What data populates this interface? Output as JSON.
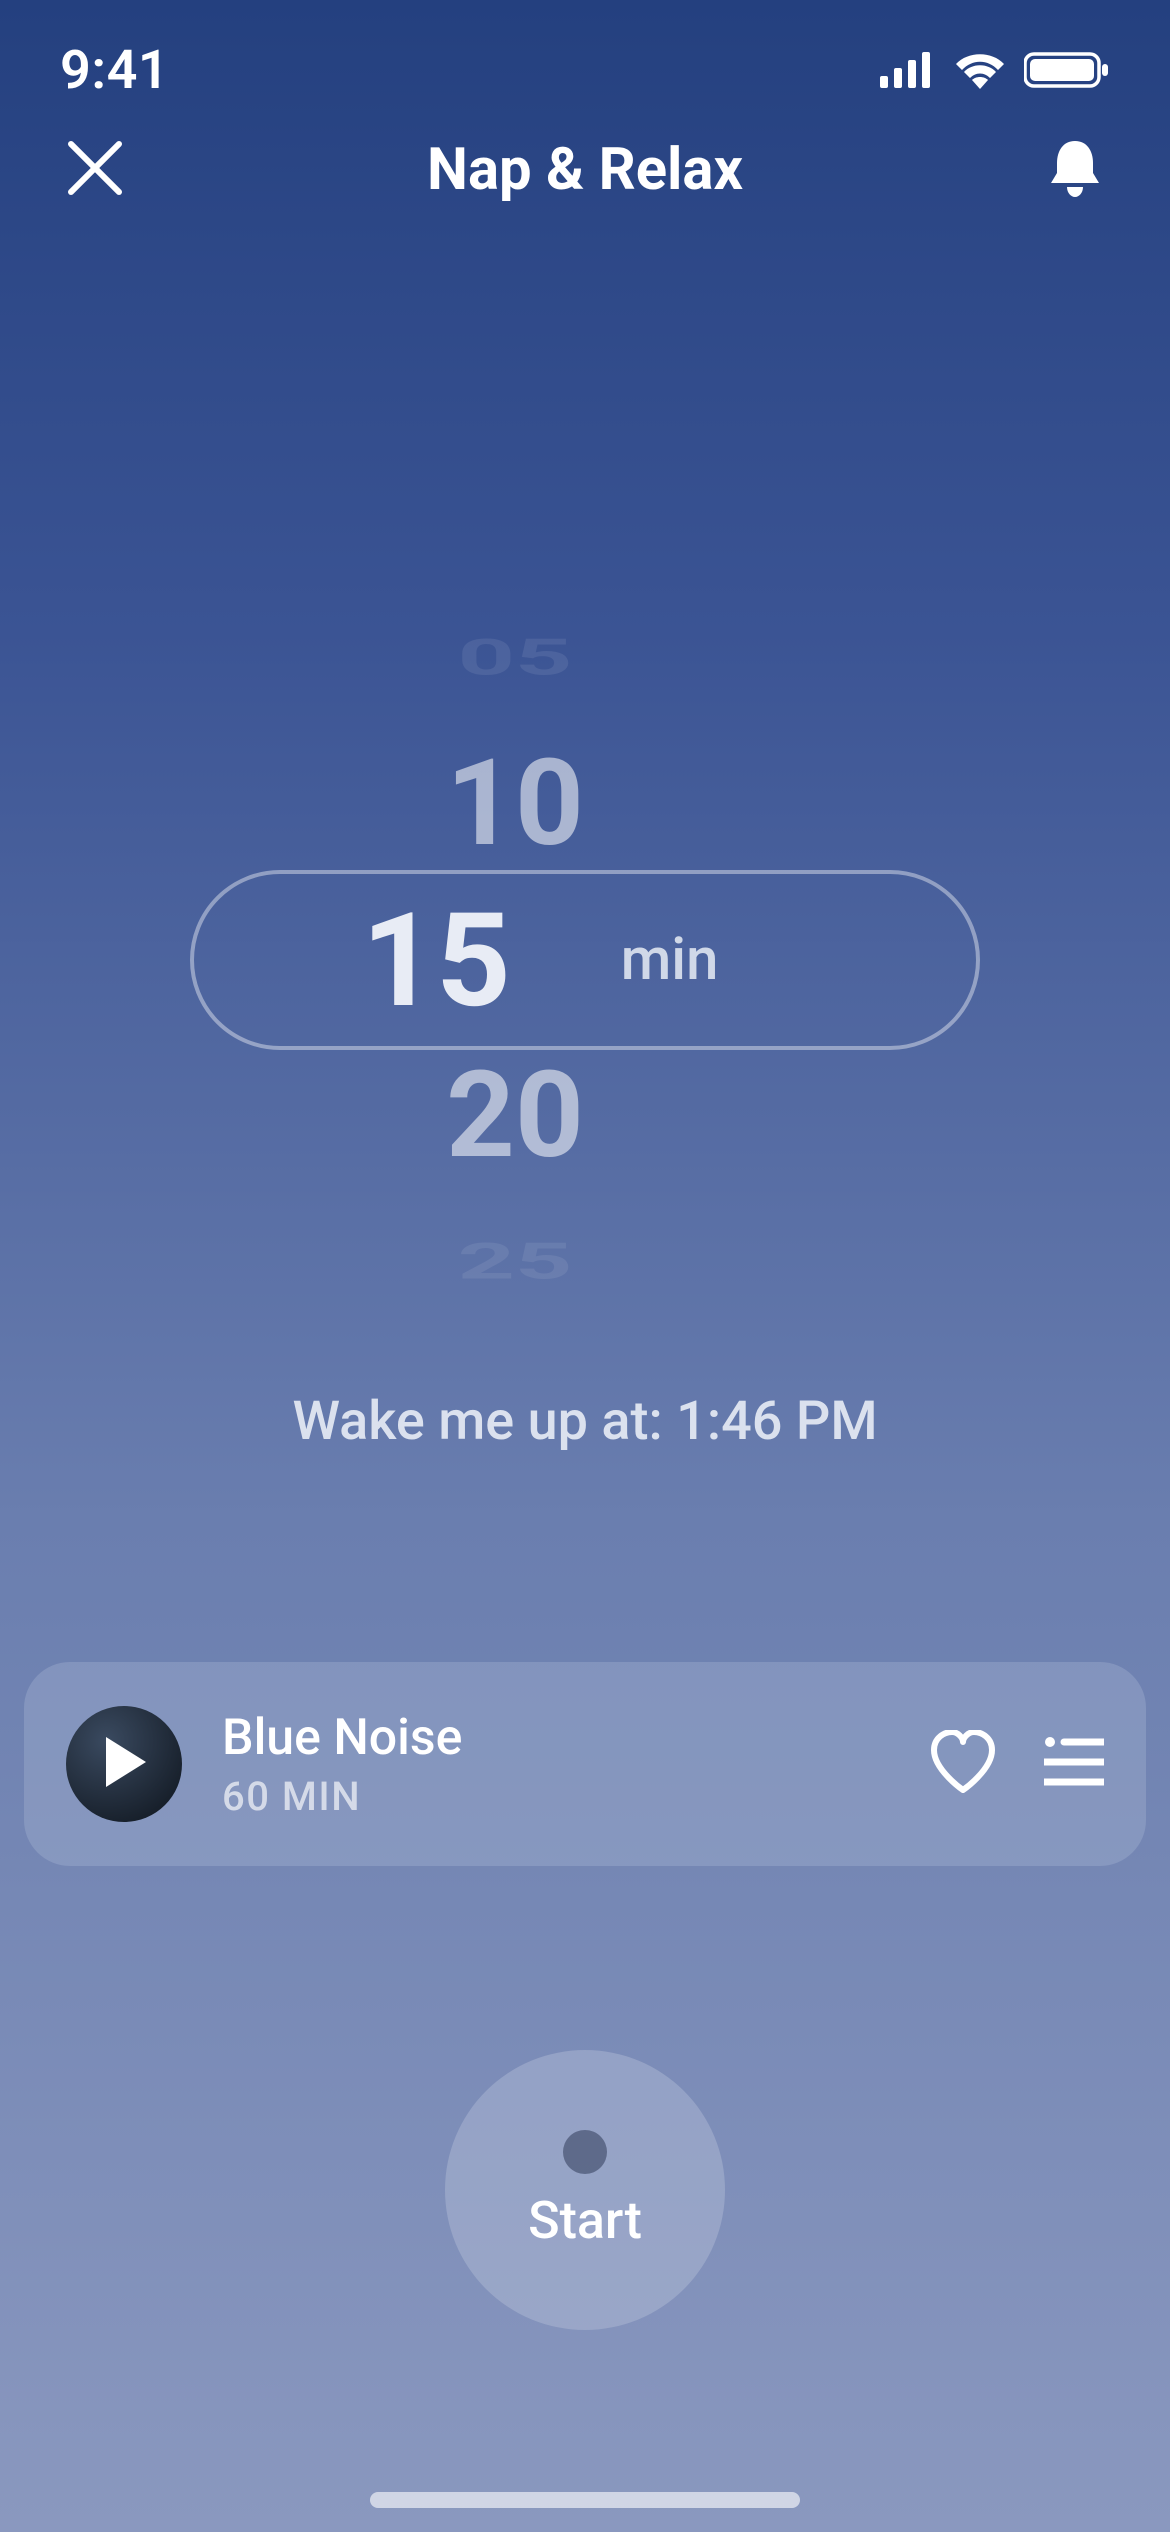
{
  "status": {
    "time": "9:41"
  },
  "header": {
    "title": "Nap & Relax"
  },
  "picker": {
    "options": [
      "05",
      "10",
      "15",
      "20",
      "25"
    ],
    "selected": "15",
    "unit": "min"
  },
  "wake": {
    "label": "Wake me up at: 1:46 PM"
  },
  "sound": {
    "title": "Blue Noise",
    "subtitle": "60 MIN"
  },
  "start": {
    "label": "Start"
  }
}
